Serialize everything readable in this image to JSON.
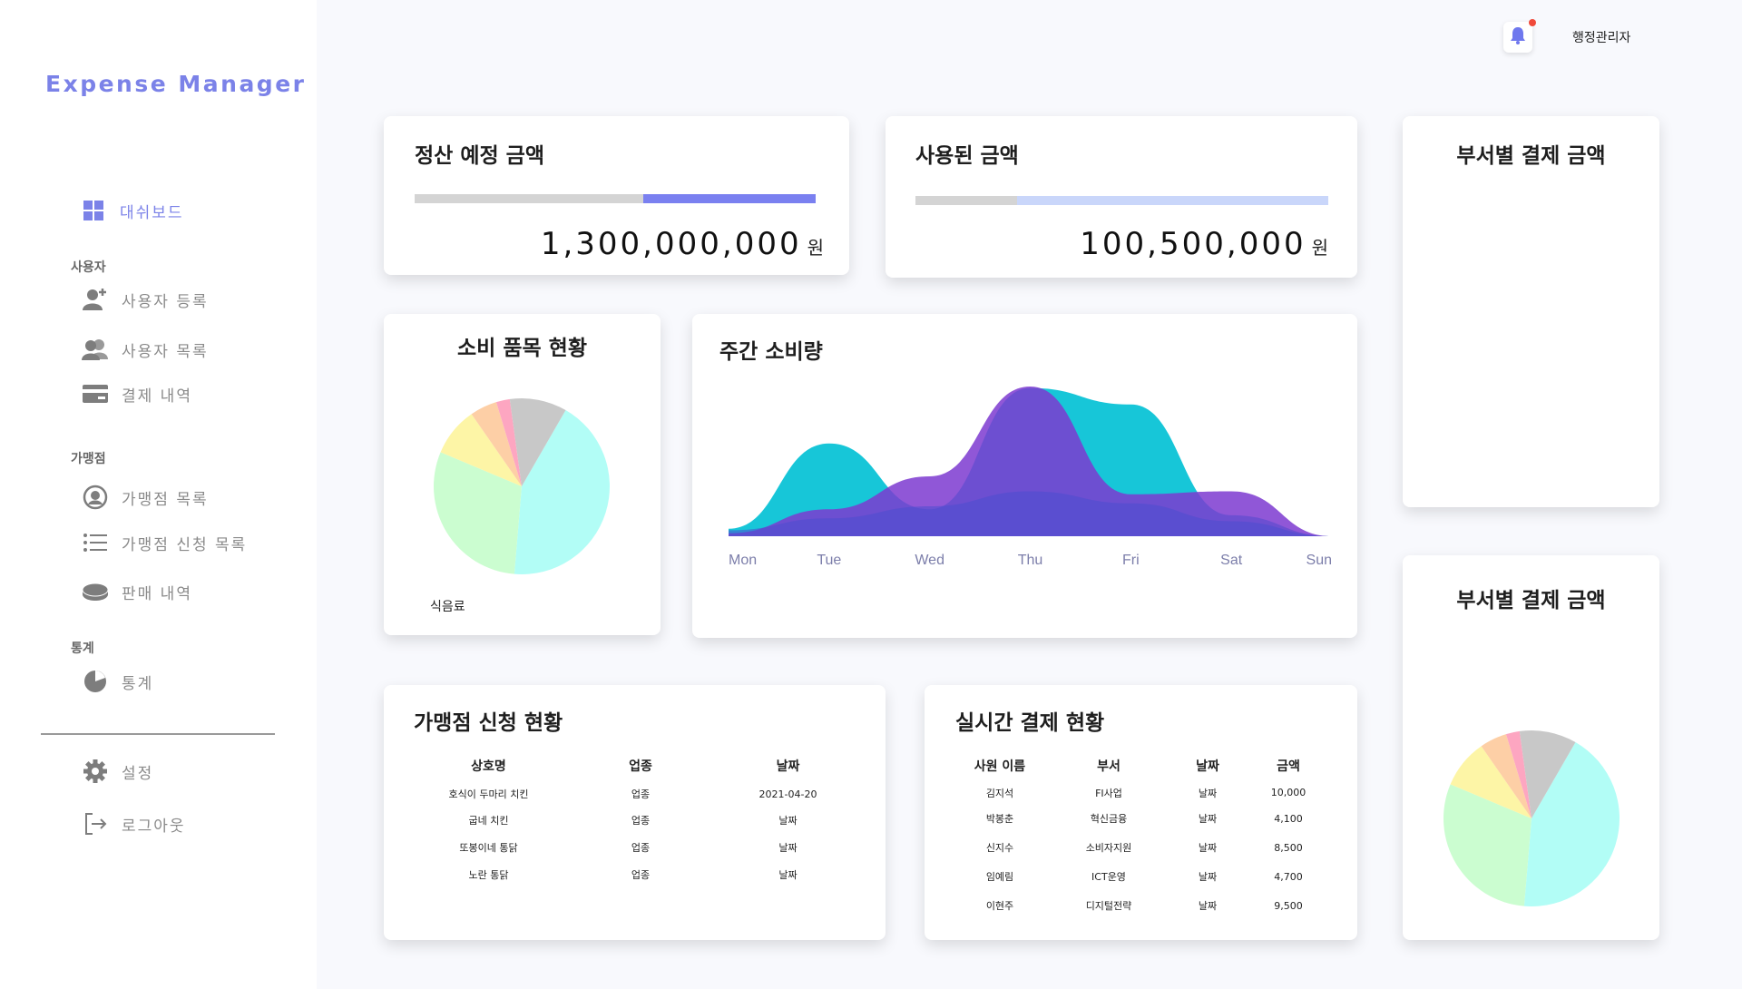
{
  "app": {
    "title": "Expense Manager"
  },
  "sidebar": {
    "dashboard_label": "대쉬보드",
    "sections": {
      "users": "사용자",
      "merchants": "가맹점",
      "stats": "통계"
    },
    "items": {
      "user_register": "사용자 등록",
      "user_list": "사용자 목록",
      "payment_history": "결제 내역",
      "merchant_list": "가맹점 목록",
      "merchant_apply_list": "가맹점 신청 목록",
      "sales_history": "판매 내역",
      "stats": "통계",
      "settings": "설정",
      "logout": "로그아웃"
    }
  },
  "header": {
    "user_name": "행정관리자"
  },
  "cards": {
    "expected_settlement": {
      "title": "정산 예정 금액",
      "amount": "1,300,000,000",
      "unit": "원",
      "progress": 0.43
    },
    "used_amount": {
      "title": "사용된 금액",
      "amount": "100,500,000",
      "unit": "원",
      "progress": 0.24
    },
    "dept_payment_top": {
      "title": "부서별 결제 금액"
    },
    "dept_payment_bottom": {
      "title": "부서별 결제 금액"
    },
    "consumption_items": {
      "title": "소비 품목 현황",
      "label": "식음료"
    },
    "weekly": {
      "title": "주간 소비량"
    },
    "merchant_applications": {
      "title": "가맹점 신청 현황",
      "columns": [
        "상호명",
        "업종",
        "날짜"
      ],
      "rows": [
        [
          "호식이 두마리 치킨",
          "업종",
          "2021-04-20"
        ],
        [
          "굽네 치킨",
          "업종",
          "날짜"
        ],
        [
          "또봉이네 통닭",
          "업종",
          "날짜"
        ],
        [
          "노란 통닭",
          "업종",
          "날짜"
        ]
      ]
    },
    "realtime_payments": {
      "title": "실시간 결제 현황",
      "columns": [
        "사원 이름",
        "부서",
        "날짜",
        "금액"
      ],
      "rows": [
        [
          "김지석",
          "FI사업",
          "날짜",
          "10,000"
        ],
        [
          "박봉춘",
          "혁신금융",
          "날짜",
          "4,100"
        ],
        [
          "신지수",
          "소비자지원",
          "날짜",
          "8,500"
        ],
        [
          "임예림",
          "ICT운영",
          "날짜",
          "4,700"
        ],
        [
          "이현주",
          "디지털전략",
          "날짜",
          "9,500"
        ]
      ]
    }
  },
  "colors": {
    "accent": "#7b82e8",
    "progress_fill_1": "#7a80f0",
    "progress_fill_2": "#c9d6fa",
    "area_teal": "#0bc3d6",
    "area_purple": "#7d3ad0",
    "area_indigo": "#4a4fd0",
    "notification_dot": "#f04a3a",
    "pie": [
      "#b2fdf6",
      "#cbfdd0",
      "#fdf5a6",
      "#fdcfa6",
      "#fda6c1",
      "#c8c8c8"
    ]
  },
  "chart_data": [
    {
      "type": "pie",
      "title": "소비 품목 현황",
      "labels": [
        "식음료"
      ],
      "values": [
        43,
        30,
        9,
        5,
        2.5,
        10.5
      ]
    },
    {
      "type": "area",
      "title": "주간 소비량",
      "categories": [
        "Mon",
        "Tue",
        "Wed",
        "Thu",
        "Fri",
        "Sat",
        "Sun"
      ],
      "series": [
        {
          "values": [
            5,
            62,
            18,
            99,
            88,
            14,
            0
          ]
        },
        {
          "values": [
            2,
            18,
            40,
            100,
            28,
            30,
            0
          ]
        },
        {
          "values": [
            4,
            12,
            20,
            30,
            22,
            10,
            0
          ]
        }
      ]
    },
    {
      "type": "pie",
      "title": "부서별 결제 금액",
      "values": [
        43,
        30,
        9,
        5,
        2.5,
        10.5
      ]
    }
  ]
}
